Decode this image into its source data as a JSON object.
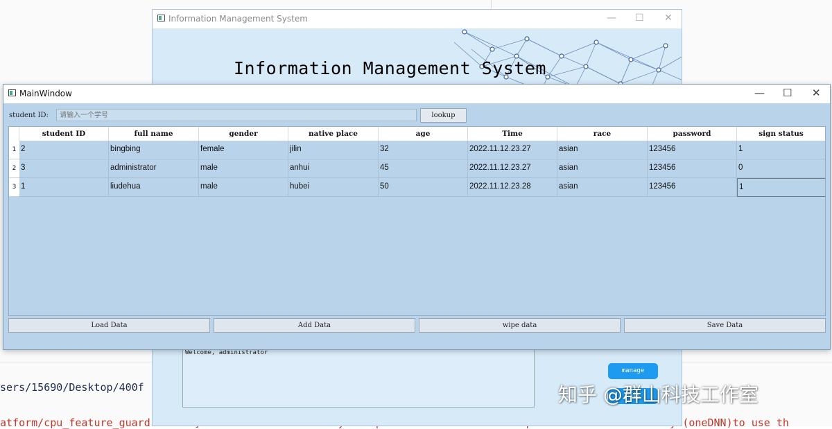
{
  "background": {
    "console_path": "sers/15690/Desktop/400f",
    "console_warning": "atform/cpu_feature_guard.cc:193] This TensorFlow binary is optimized with oneAPI Deep Neural Network Library (oneDNN)to use th"
  },
  "back_window": {
    "title": "Information Management System",
    "heading": "Information Management System",
    "welcome_text": "Welcome, administrator",
    "manage_label": "manage",
    "exit_label": "Exit"
  },
  "main_window": {
    "title": "MainWindow",
    "student_id_label": "student ID:",
    "student_id_placeholder": "请输入一个学号",
    "lookup_label": "lookup",
    "columns": [
      "student ID",
      "full name",
      "gender",
      "native place",
      "age",
      "Time",
      "race",
      "password",
      "sign status"
    ],
    "rows": [
      {
        "num": "1",
        "cells": [
          "2",
          "bingbing",
          "female",
          "jilin",
          "32",
          "2022.11.12.23.27",
          "asian",
          "123456",
          "1"
        ]
      },
      {
        "num": "2",
        "cells": [
          "3",
          "administrator",
          "male",
          "anhui",
          "45",
          "2022.11.12.23.27",
          "asian",
          "123456",
          "0"
        ]
      },
      {
        "num": "3",
        "cells": [
          "1",
          "liudehua",
          "male",
          "hubei",
          "50",
          "2022.11.12.23.28",
          "asian",
          "123456",
          "1"
        ]
      }
    ],
    "buttons": {
      "load": "Load Data",
      "add": "Add Data",
      "wipe": "wipe data",
      "save": "Save Data"
    }
  },
  "watermark": {
    "text": "知乎 @群山科技工作室",
    "color": "#ffffff"
  }
}
